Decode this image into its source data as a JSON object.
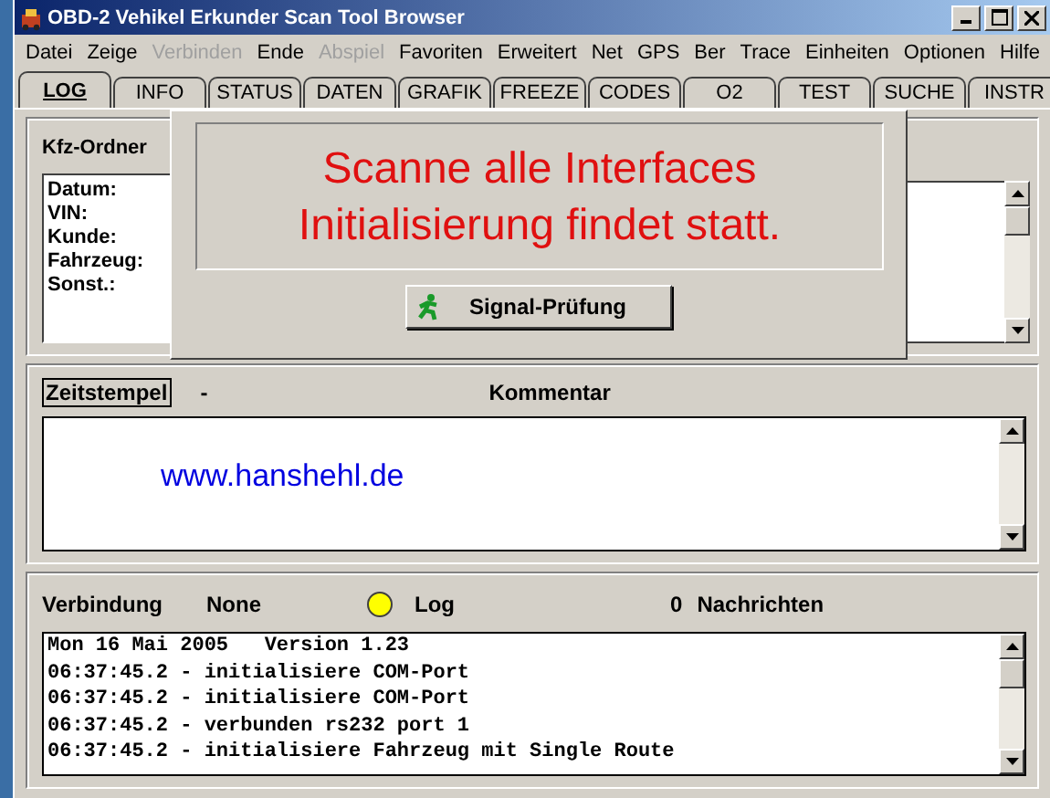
{
  "window": {
    "title": "OBD-2 Vehikel Erkunder Scan Tool Browser"
  },
  "menu": [
    {
      "label": "Datei",
      "disabled": false
    },
    {
      "label": "Zeige",
      "disabled": false
    },
    {
      "label": "Verbinden",
      "disabled": true
    },
    {
      "label": "Ende",
      "disabled": false
    },
    {
      "label": "Abspiel",
      "disabled": true
    },
    {
      "label": "Favoriten",
      "disabled": false
    },
    {
      "label": "Erweitert",
      "disabled": false
    },
    {
      "label": "Net",
      "disabled": false
    },
    {
      "label": "GPS",
      "disabled": false
    },
    {
      "label": "Ber",
      "disabled": false
    },
    {
      "label": "Trace",
      "disabled": false
    },
    {
      "label": "Einheiten",
      "disabled": false
    },
    {
      "label": "Optionen",
      "disabled": false
    },
    {
      "label": "Hilfe",
      "disabled": false
    }
  ],
  "tabs": [
    {
      "label": "LOG",
      "selected": true
    },
    {
      "label": "INFO",
      "selected": false
    },
    {
      "label": "STATUS",
      "selected": false
    },
    {
      "label": "DATEN",
      "selected": false
    },
    {
      "label": "GRAFIK",
      "selected": false
    },
    {
      "label": "FREEZE",
      "selected": false
    },
    {
      "label": "CODES",
      "selected": false
    },
    {
      "label": "O2",
      "selected": false
    },
    {
      "label": "TEST",
      "selected": false
    },
    {
      "label": "SUCHE",
      "selected": false
    },
    {
      "label": "INSTR",
      "selected": false
    }
  ],
  "vehicle_folder": {
    "title": "Kfz-Ordner",
    "fields": [
      "Datum:",
      "VIN:",
      "Kunde:",
      "Fahrzeug:",
      "Sonst.:"
    ]
  },
  "dialog": {
    "message": [
      "Scanne alle Interfaces",
      "Initialisierung findet statt."
    ],
    "button": "Signal-Prüfung"
  },
  "comment": {
    "timestamp_button": "Zeitstempel",
    "separator": "-",
    "title": "Kommentar",
    "text": "www.hanshehl.de"
  },
  "log": {
    "connection_label": "Verbindung",
    "connection_value": "None",
    "indicator_on": true,
    "indicator_label": "Log",
    "message_count": "0",
    "messages_label": "Nachrichten",
    "lines": [
      "Mon 16 Mai 2005   Version 1.23",
      "06:37:45.2 - initialisiere COM-Port",
      "06:37:45.2 - initialisiere COM-Port",
      "06:37:45.2 - verbunden rs232 port 1",
      "06:37:45.2 - initialisiere Fahrzeug mit Single Route"
    ]
  }
}
